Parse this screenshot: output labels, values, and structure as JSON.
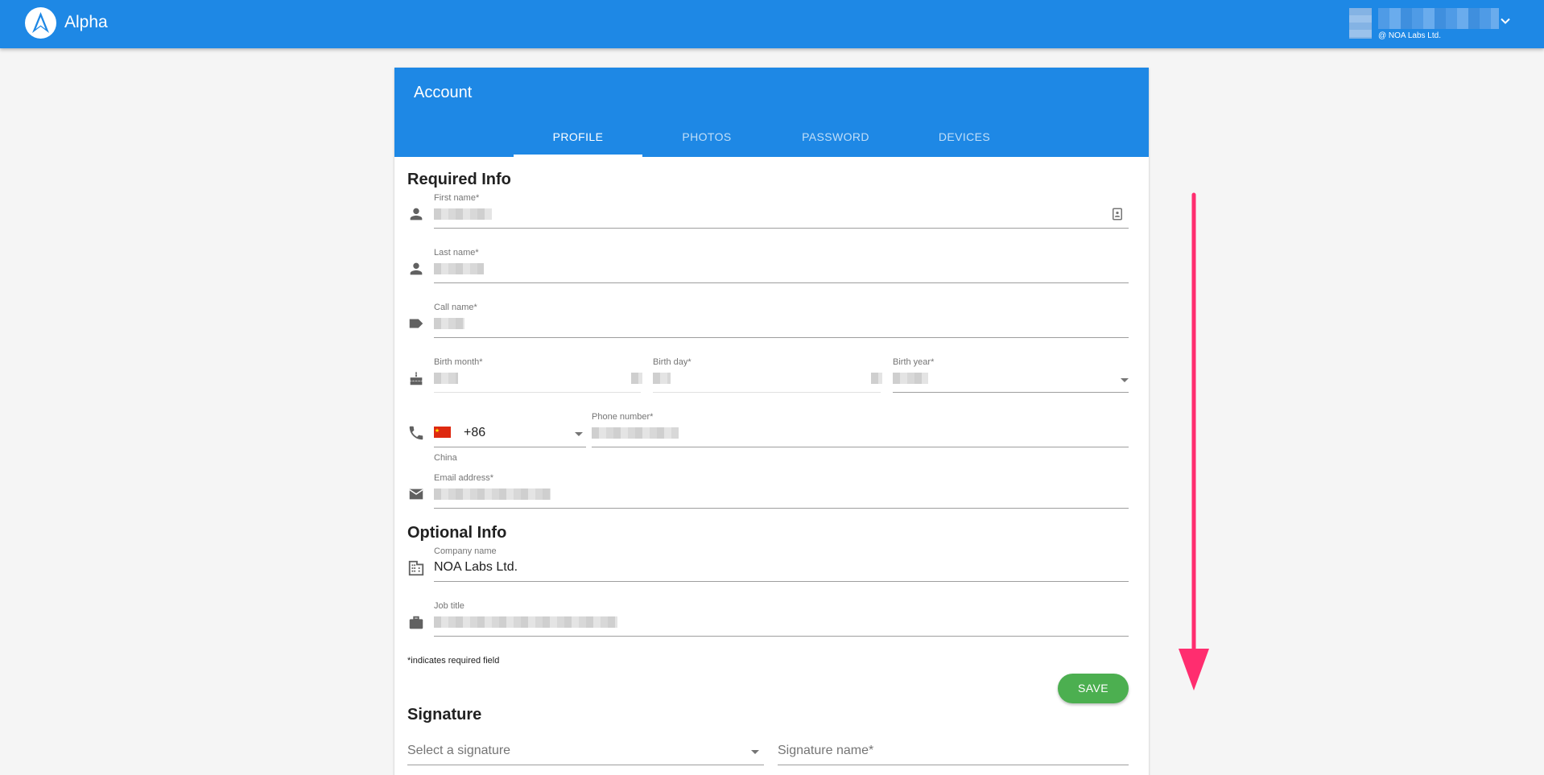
{
  "app": {
    "title": "Alpha",
    "user_org": "@ NOA Labs Ltd."
  },
  "card": {
    "title": "Account",
    "tabs": [
      {
        "label": "PROFILE",
        "active": true
      },
      {
        "label": "PHOTOS",
        "active": false
      },
      {
        "label": "PASSWORD",
        "active": false
      },
      {
        "label": "DEVICES",
        "active": false
      }
    ]
  },
  "required_info": {
    "title": "Required Info",
    "first_name_label": "First name*",
    "last_name_label": "Last name*",
    "call_name_label": "Call name*",
    "birth_month_label": "Birth month*",
    "birth_day_label": "Birth day*",
    "birth_year_label": "Birth year*",
    "phone_code": "+86",
    "phone_country": "China",
    "phone_number_label": "Phone number*",
    "email_label": "Email address*"
  },
  "optional_info": {
    "title": "Optional Info",
    "company_label": "Company name",
    "company_value": "NOA Labs Ltd.",
    "job_title_label": "Job title"
  },
  "footer": {
    "required_note": "*indicates required field",
    "save_label": "SAVE"
  },
  "signature": {
    "title": "Signature",
    "select_placeholder": "Select a signature",
    "name_placeholder": "Signature name*"
  },
  "colors": {
    "primary": "#1e88e5",
    "save": "#4caf50",
    "scroll_arrow": "#ff2d6f"
  },
  "icons": [
    "logo-icon",
    "chevron-down-icon",
    "person-icon",
    "contact-card-icon",
    "label-icon",
    "cake-icon",
    "phone-icon",
    "china-flag-icon",
    "email-icon",
    "business-icon",
    "briefcase-icon",
    "dropdown-arrow-icon",
    "scroll-down-arrow-icon"
  ]
}
